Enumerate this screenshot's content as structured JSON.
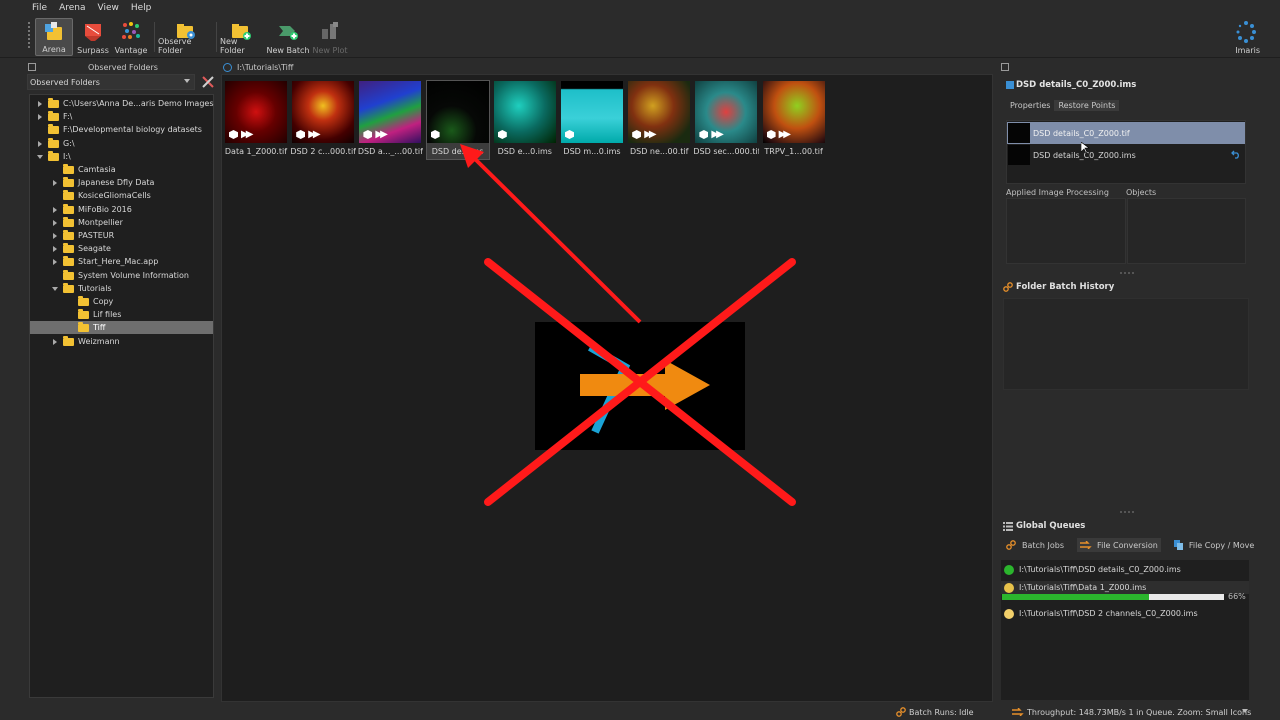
{
  "menu": [
    "File",
    "Arena",
    "View",
    "Help"
  ],
  "toolbar": {
    "buttons": [
      {
        "label": "Arena",
        "icon": "arena-icon"
      },
      {
        "label": "Surpass",
        "icon": "surpass-icon"
      },
      {
        "label": "Vantage",
        "icon": "vantage-icon"
      },
      {
        "label": "Observe Folder",
        "icon": "observe-folder-icon"
      },
      {
        "label": "New Folder",
        "icon": "new-folder-icon"
      },
      {
        "label": "New Batch",
        "icon": "new-batch-icon"
      },
      {
        "label": "New Plot",
        "icon": "new-plot-icon"
      }
    ],
    "brand": "Imaris"
  },
  "left": {
    "header": "Observed Folders",
    "select_value": "Observed Folders",
    "tree": [
      {
        "label": "C:\\Users\\Anna De...aris Demo Images",
        "level": 0,
        "expand": "right"
      },
      {
        "label": "F:\\",
        "level": 0,
        "expand": "right"
      },
      {
        "label": "F:\\Developmental biology datasets",
        "level": 0,
        "expand": "none"
      },
      {
        "label": "G:\\",
        "level": 0,
        "expand": "right"
      },
      {
        "label": "I:\\",
        "level": 0,
        "expand": "down"
      },
      {
        "label": "Camtasia",
        "level": 1,
        "expand": "none"
      },
      {
        "label": "Japanese Dfly Data",
        "level": 1,
        "expand": "right"
      },
      {
        "label": "KosiceGliomaCells",
        "level": 1,
        "expand": "none"
      },
      {
        "label": "MiFoBio 2016",
        "level": 1,
        "expand": "right"
      },
      {
        "label": "Montpellier",
        "level": 1,
        "expand": "right"
      },
      {
        "label": "PASTEUR",
        "level": 1,
        "expand": "right"
      },
      {
        "label": "Seagate",
        "level": 1,
        "expand": "right"
      },
      {
        "label": "Start_Here_Mac.app",
        "level": 1,
        "expand": "right"
      },
      {
        "label": "System Volume Information",
        "level": 1,
        "expand": "none"
      },
      {
        "label": "Tutorials",
        "level": 1,
        "expand": "down"
      },
      {
        "label": "Copy",
        "level": 2,
        "expand": "none"
      },
      {
        "label": "Lif files",
        "level": 2,
        "expand": "none"
      },
      {
        "label": "Tiff",
        "level": 2,
        "expand": "none",
        "selected": true
      },
      {
        "label": "Weizmann",
        "level": 1,
        "expand": "right"
      }
    ]
  },
  "center": {
    "path": "I:\\Tutorials\\Tiff",
    "thumbs": [
      {
        "caption": "Data 1_Z000.tif",
        "convert": true
      },
      {
        "caption": "DSD 2 c...000.tif",
        "convert": true
      },
      {
        "caption": "DSD a..._...00.tif",
        "convert": true
      },
      {
        "caption": "DSD de...ims",
        "convert": false,
        "selected": true
      },
      {
        "caption": "DSD e...0.ims",
        "convert": false
      },
      {
        "caption": "DSD m...0.ims",
        "convert": false
      },
      {
        "caption": "DSD ne...00.tif",
        "convert": true
      },
      {
        "caption": "DSD sec...000.tif",
        "convert": true
      },
      {
        "caption": "TRPV_1...00.tif",
        "convert": true
      }
    ]
  },
  "right": {
    "title": "DSD details_C0_Z000.ims",
    "tabs": [
      "Properties",
      "Restore Points"
    ],
    "restore_points": [
      "DSD details_C0_Z000.tif",
      "DSD details_C0_Z000.ims"
    ],
    "aip_label": "Applied Image Processing",
    "objects_label": "Objects",
    "history_title": "Folder Batch History",
    "queues_title": "Global Queues",
    "queue_tabs": [
      "Batch Jobs",
      "File Conversion",
      "File Copy / Move"
    ],
    "queue_items": [
      {
        "path": "I:\\Tutorials\\Tiff\\DSD details_C0_Z000.ims",
        "status": "done"
      },
      {
        "path": "I:\\Tutorials\\Tiff\\Data 1_Z000.ims",
        "status": "running"
      },
      {
        "path": "I:\\Tutorials\\Tiff\\DSD 2 channels_C0_Z000.ims",
        "status": "pending"
      }
    ],
    "progress": 66,
    "progress_text": "66%"
  },
  "status": {
    "batch_runs_label": "Batch Runs:",
    "batch_runs_value": "Idle",
    "throughput": "Throughput:   148.73MB/s   1 in Queue. Zoom: Small Icons"
  },
  "colors": {
    "accent_red": "#ff1a1a",
    "folder_yellow": "#f2c133",
    "progress_green": "#2bb52d",
    "selection_blue": "#7f8eaa"
  }
}
